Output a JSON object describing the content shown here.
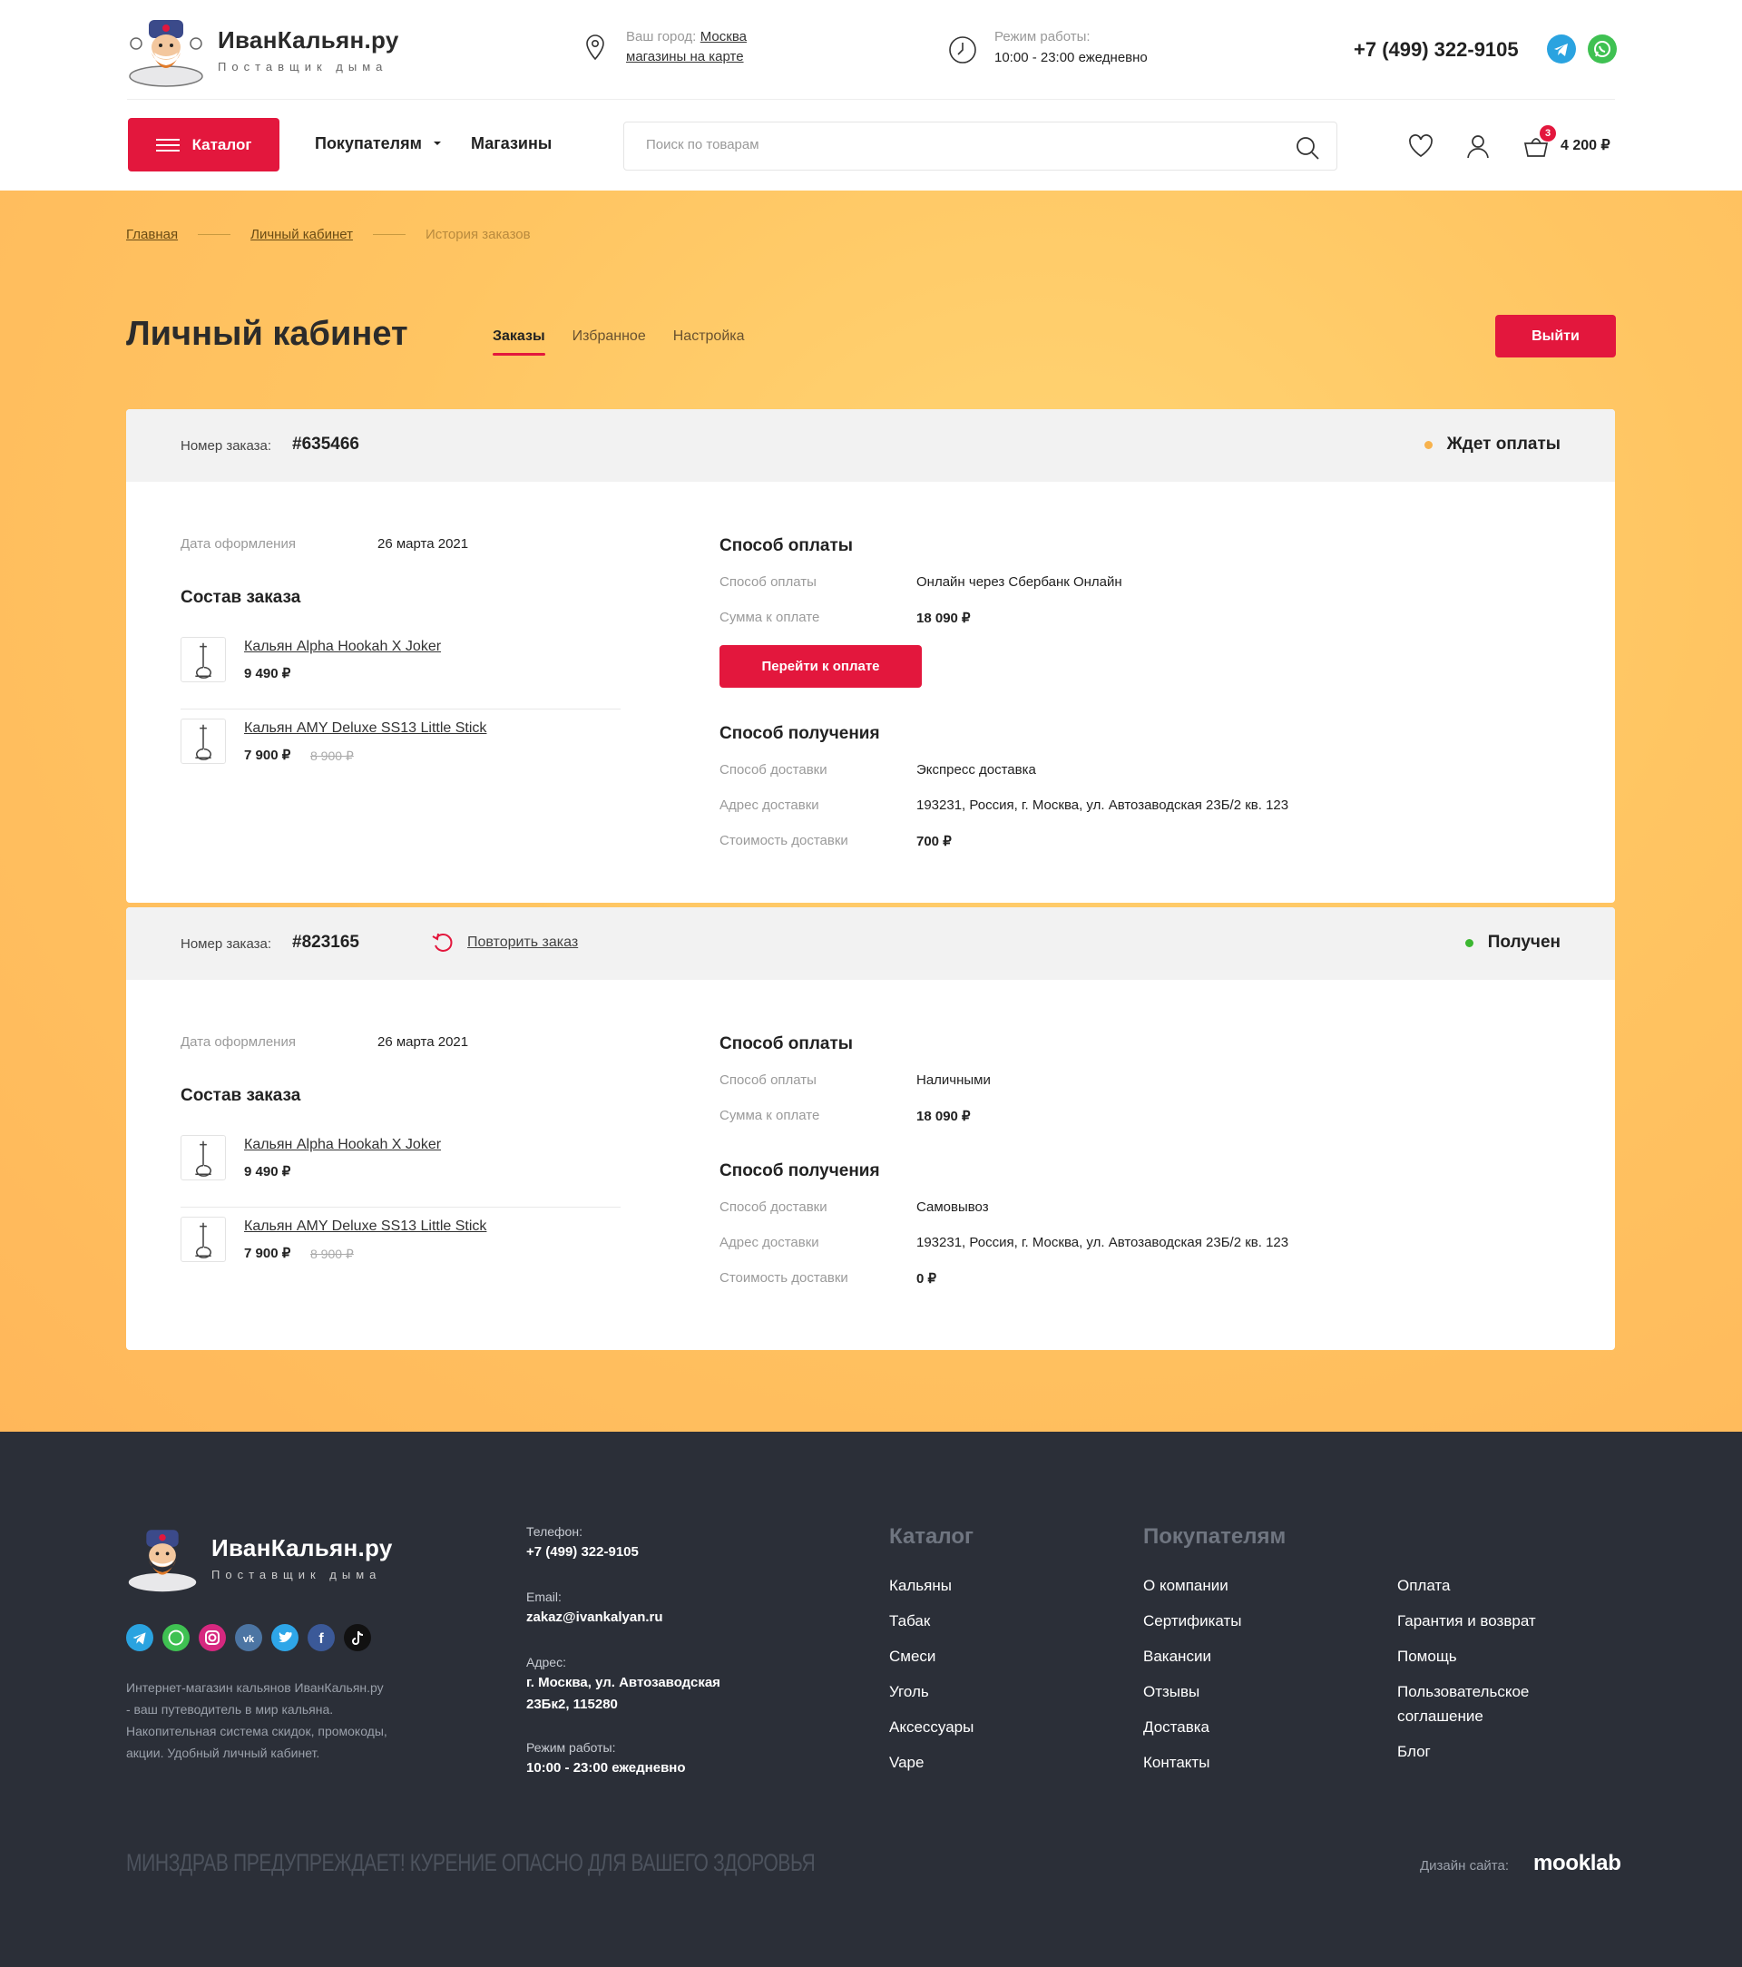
{
  "header": {
    "logo_title": "ИванКальян.ру",
    "logo_sub": "Поставщик дыма",
    "city_label": "Ваш город:",
    "city_value": "Москва",
    "stores_map": "магазины на карте",
    "hours_label": "Режим работы:",
    "hours_value": "10:00 - 23:00 ежедневно",
    "phone": "+7 (499) 322-9105",
    "telegram_color": "#2aa3e0",
    "whatsapp_color": "#3fc152"
  },
  "nav": {
    "catalog": "Каталог",
    "buyers": "Покупателям",
    "stores": "Магазины",
    "search_placeholder": "Поиск по товарам",
    "cart_count": "3",
    "cart_sum": "4 200 ₽"
  },
  "breadcrumb": {
    "home": "Главная",
    "account": "Личный кабинет",
    "current": "История заказов"
  },
  "account": {
    "title": "Личный кабинет",
    "tabs": [
      "Заказы",
      "Избранное",
      "Настройка"
    ],
    "logout": "Выйти"
  },
  "labels": {
    "order_number": "Номер заказа:",
    "order_date": "Дата оформления",
    "composition": "Состав заказа",
    "payment_title": "Способ оплаты",
    "payment_method": "Способ оплаты",
    "amount_due": "Сумма к оплате",
    "delivery_title": "Способ получения",
    "delivery_method": "Способ доставки",
    "delivery_address": "Адрес доставки",
    "delivery_cost": "Стоимость доставки",
    "pay_button": "Перейти к оплате",
    "repeat_order": "Повторить заказ"
  },
  "orders": [
    {
      "number": "#635466",
      "status": "Ждет оплаты",
      "status_color": "#f7b24d",
      "date": "26 марта 2021",
      "items": [
        {
          "name": "Кальян Alpha Hookah X Joker",
          "price": "9 490 ₽",
          "old_price": ""
        },
        {
          "name": "Кальян AMY Deluxe SS13 Little Stick",
          "price": "7 900 ₽",
          "old_price": "8 900 ₽"
        }
      ],
      "payment": "Онлайн через Сбербанк Онлайн",
      "amount": "18 090 ₽",
      "delivery": "Экспресс доставка",
      "address": "193231, Россия, г. Москва, ул. Автозаводская 23Б/2 кв. 123",
      "delivery_cost": "700 ₽"
    },
    {
      "number": "#823165",
      "status": "Получен",
      "status_color": "#3cb731",
      "date": "26 марта 2021",
      "items": [
        {
          "name": "Кальян Alpha Hookah X Joker",
          "price": "9 490 ₽",
          "old_price": ""
        },
        {
          "name": "Кальян AMY Deluxe SS13 Little Stick",
          "price": "7 900 ₽",
          "old_price": "8 900 ₽"
        }
      ],
      "payment": "Наличными",
      "amount": "18 090 ₽",
      "delivery": "Самовывоз",
      "address": "193231, Россия, г. Москва, ул. Автозаводская 23Б/2 кв. 123",
      "delivery_cost": "0 ₽"
    }
  ],
  "footer": {
    "description": "Интернет-магазин кальянов ИванКальян.ру - ваш путеводитель в мир кальяна. Накопительная система скидок, промокоды, акции. Удобный личный кабинет.",
    "phone_label": "Телефон:",
    "phone": "+7 (499) 322-9105",
    "email_label": "Email:",
    "email": "zakaz@ivankalyan.ru",
    "address_label": "Адрес:",
    "address_line1": "г. Москва, ул. Автозаводская",
    "address_line2": "23Бк2, 115280",
    "hours_label": "Режим работы:",
    "hours": "10:00 - 23:00 ежедневно",
    "catalog_title": "Каталог",
    "catalog_links": [
      "Кальяны",
      "Табак",
      "Смеси",
      "Уголь",
      "Аксессуары",
      "Vape"
    ],
    "buyers_title": "Покупателям",
    "buyers_links": [
      "О компании",
      "Сертификаты",
      "Вакансии",
      "Отзывы",
      "Доставка",
      "Контакты"
    ],
    "info_links": [
      "Оплата",
      "Гарантия и возврат",
      "Помощь",
      "Пользовательское соглашение",
      "Блог"
    ],
    "social_icons": [
      "telegram-icon",
      "whatsapp-icon",
      "instagram-icon",
      "vk-icon",
      "twitter-icon",
      "facebook-icon",
      "tiktok-icon"
    ],
    "warning": "МИНЗДРАВ ПРЕДУПРЕЖДАЕТ! КУРЕНИЕ ОПАСНО ДЛЯ ВАШЕГО ЗДОРОВЬЯ",
    "design_label": "Дизайн сайта:",
    "design_brand": "mooklab"
  }
}
